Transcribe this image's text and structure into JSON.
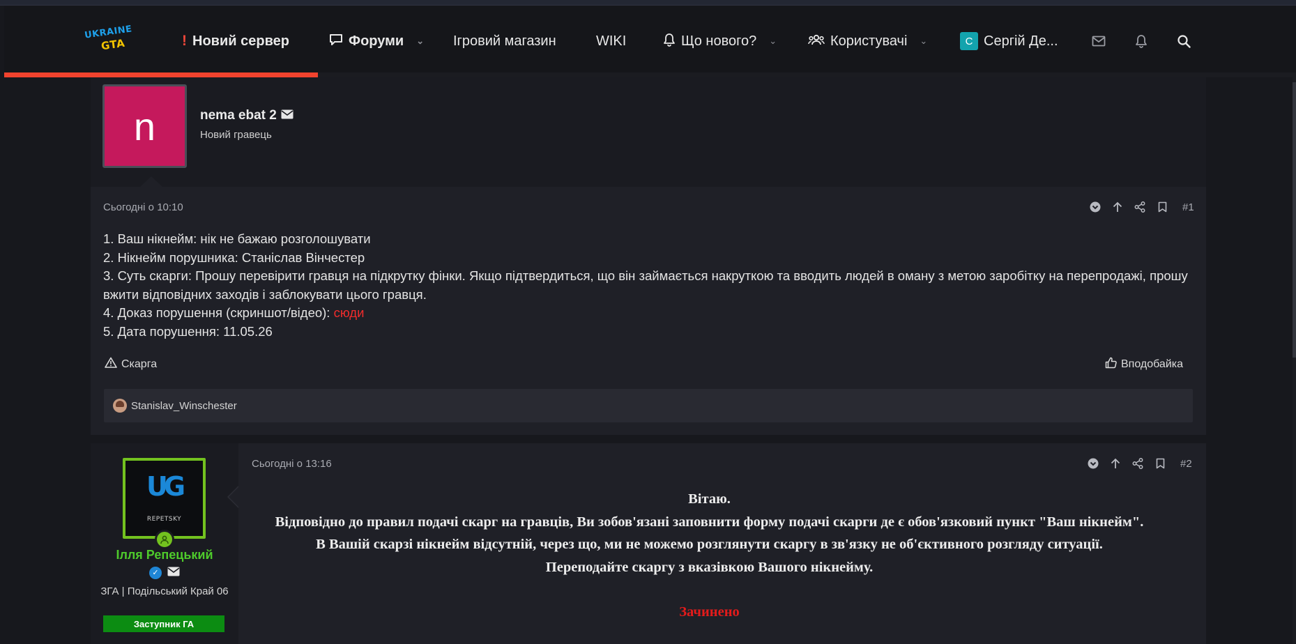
{
  "nav": {
    "logo_line1": "UKRAINE",
    "logo_line2": "GTA",
    "items": [
      {
        "label": "Новий сервер",
        "icon": "exclamation-icon"
      },
      {
        "label": "Форуми",
        "icon": "comment-icon"
      },
      {
        "label": "Ігровий магазин"
      },
      {
        "label": "WIKI"
      },
      {
        "label": "Що нового?",
        "icon": "bell-icon"
      },
      {
        "label": "Користувачі",
        "icon": "users-icon"
      }
    ],
    "account": {
      "initial": "С",
      "name": "Сергій Де..."
    },
    "progress": 0.243
  },
  "post1": {
    "author": "nema ebat 2",
    "avatar_letter": "n",
    "author_title": "Новий гравець",
    "date": "Сьогодні о 10:10",
    "number": "#1",
    "lines": [
      "1. Ваш нікнейм: нік не бажаю розголошувати",
      "2. Нікнейм порушника: Станіслав Вінчестер",
      "3. Суть скарги: Прошу перевірити гравця на підкрутку фінки. Якщо підтвердиться, що він займається накруткою та вводить людей в оману з метою заробітку на перепродажі, прошу вжити відповідних заходів і заблокувати цього гравця.",
      "4. Доказ порушення (скриншот/відео): ",
      "5. Дата порушення: 11.05.26"
    ],
    "proof_link": "сюди",
    "report_label": "Скарга",
    "like_label": "Вподобайка",
    "reaction_user": "Stanislav_Winschester"
  },
  "post2": {
    "author": "Ілля Репецький",
    "avatar_caption": "REPETSKY",
    "avatar_mark": "UG",
    "author_title": "ЗГА | Подільський Край 06",
    "badge": "Заступник ГА",
    "date": "Сьогодні о 13:16",
    "number": "#2",
    "lines": [
      "Вітаю.",
      "Відповідно до правил подачі скарг на гравців, Ви зобов'язані заповнити форму подачі скарги де є обов'язковий пункт \"Ваш нікнейм\".",
      "В Вашій скарзі нікнейм відсутній, через що, ми не можемо розглянути скаргу в зв'язку не об'єктивного розгляду ситуації.",
      "Переподайте скаргу з вказівкою Вашого нікнейму."
    ],
    "status": "Зачинено"
  },
  "colors": {
    "accent": "#f1432e",
    "link_red": "#f12c2c",
    "staff_green": "#4ecb2b",
    "badge_green": "#0c8c12",
    "avatar_pink": "#c5195c",
    "closed_red": "#e31b1b"
  }
}
